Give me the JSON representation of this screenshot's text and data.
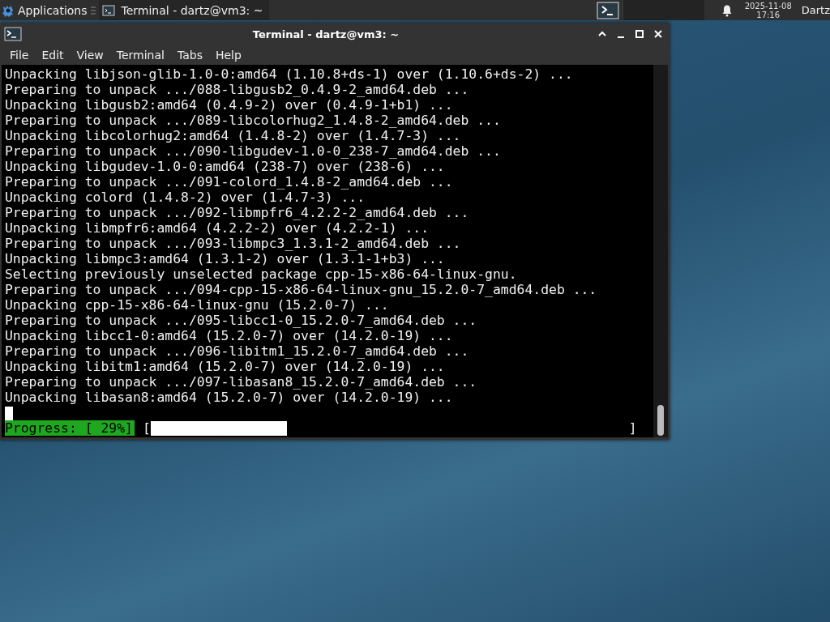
{
  "panel": {
    "applications": "Applications",
    "task": "Terminal - dartz@vm3: ~",
    "clock_date": "2025-11-08",
    "clock_time": "17:16",
    "user": "Dartz"
  },
  "window": {
    "title": "Terminal - dartz@vm3: ~"
  },
  "menu": [
    "File",
    "Edit",
    "View",
    "Terminal",
    "Tabs",
    "Help"
  ],
  "terminal": {
    "lines": [
      "Unpacking libjson-glib-1.0-0:amd64 (1.10.8+ds-1) over (1.10.6+ds-2) ...",
      "Preparing to unpack .../088-libgusb2_0.4.9-2_amd64.deb ...",
      "Unpacking libgusb2:amd64 (0.4.9-2) over (0.4.9-1+b1) ...",
      "Preparing to unpack .../089-libcolorhug2_1.4.8-2_amd64.deb ...",
      "Unpacking libcolorhug2:amd64 (1.4.8-2) over (1.4.7-3) ...",
      "Preparing to unpack .../090-libgudev-1.0-0_238-7_amd64.deb ...",
      "Unpacking libgudev-1.0-0:amd64 (238-7) over (238-6) ...",
      "Preparing to unpack .../091-colord_1.4.8-2_amd64.deb ...",
      "Unpacking colord (1.4.8-2) over (1.4.7-3) ...",
      "Preparing to unpack .../092-libmpfr6_4.2.2-2_amd64.deb ...",
      "Unpacking libmpfr6:amd64 (4.2.2-2) over (4.2.2-1) ...",
      "Preparing to unpack .../093-libmpc3_1.3.1-2_amd64.deb ...",
      "Unpacking libmpc3:amd64 (1.3.1-2) over (1.3.1-1+b3) ...",
      "Selecting previously unselected package cpp-15-x86-64-linux-gnu.",
      "Preparing to unpack .../094-cpp-15-x86-64-linux-gnu_15.2.0-7_amd64.deb ...",
      "Unpacking cpp-15-x86-64-linux-gnu (15.2.0-7) ...",
      "Preparing to unpack .../095-libcc1-0_15.2.0-7_amd64.deb ...",
      "Unpacking libcc1-0:amd64 (15.2.0-7) over (14.2.0-19) ...",
      "Preparing to unpack .../096-libitm1_15.2.0-7_amd64.deb ...",
      "Unpacking libitm1:amd64 (15.2.0-7) over (14.2.0-19) ...",
      "Preparing to unpack .../097-libasan8_15.2.0-7_amd64.deb ...",
      "Unpacking libasan8:amd64 (15.2.0-7) over (14.2.0-19) ..."
    ],
    "progress": {
      "label": "Progress: [ 29%]",
      "open": "[",
      "close": "]",
      "level": 0.29
    }
  }
}
